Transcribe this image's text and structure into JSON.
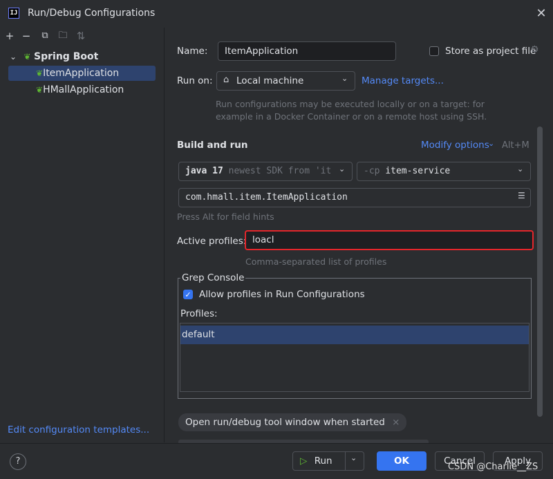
{
  "window": {
    "title": "Run/Debug Configurations",
    "logo_text": "IJ"
  },
  "toolbar": {
    "add": "+",
    "remove": "−",
    "copy": "⧉",
    "folder": "🗀",
    "sort": "⇅"
  },
  "tree": {
    "group_arrow": "⌄",
    "group_label": "Spring Boot",
    "items": [
      {
        "label": "ItemApplication"
      },
      {
        "label": "HMallApplication"
      }
    ]
  },
  "left_footer": {
    "edit_templates": "Edit configuration templates..."
  },
  "form": {
    "name_label": "Name:",
    "name_value": "ItemApplication",
    "store_label": "Store as project file",
    "run_on_label": "Run on:",
    "run_on_value": "Local machine",
    "manage_targets": "Manage targets...",
    "run_on_hint_1": "Run configurations may be executed locally or on a target: for",
    "run_on_hint_2": "example in a Docker Container or on a remote host using SSH.",
    "build_title": "Build and run",
    "modify_options": "Modify options",
    "modify_shortcut": "Alt+M",
    "jdk_value": "java 17",
    "jdk_hint": "newest SDK from 'it",
    "cp_prefix": "-cp",
    "cp_value": "item-service",
    "main_class": "com.hmall.item.ItemApplication",
    "alt_hint": "Press Alt for field hints",
    "profiles_label": "Active profiles:",
    "profiles_value": "loacl",
    "profiles_hint": "Comma-separated list of profiles",
    "grep_title": "Grep Console",
    "allow_profiles_label": "Allow profiles in Run Configurations",
    "profiles_list_label": "Profiles:",
    "profiles_list": [
      "default"
    ],
    "chip_label": "Open run/debug tool window when started",
    "chip_close": "×"
  },
  "footer": {
    "help": "?",
    "run_label": "Run",
    "ok_label": "OK",
    "cancel_label": "Cancel",
    "apply_label": "Apply"
  },
  "watermark": "CSDN @Charlie__ZS",
  "colors": {
    "accent": "#3574f0",
    "highlight_border": "#e5262b",
    "link": "#548af7"
  }
}
